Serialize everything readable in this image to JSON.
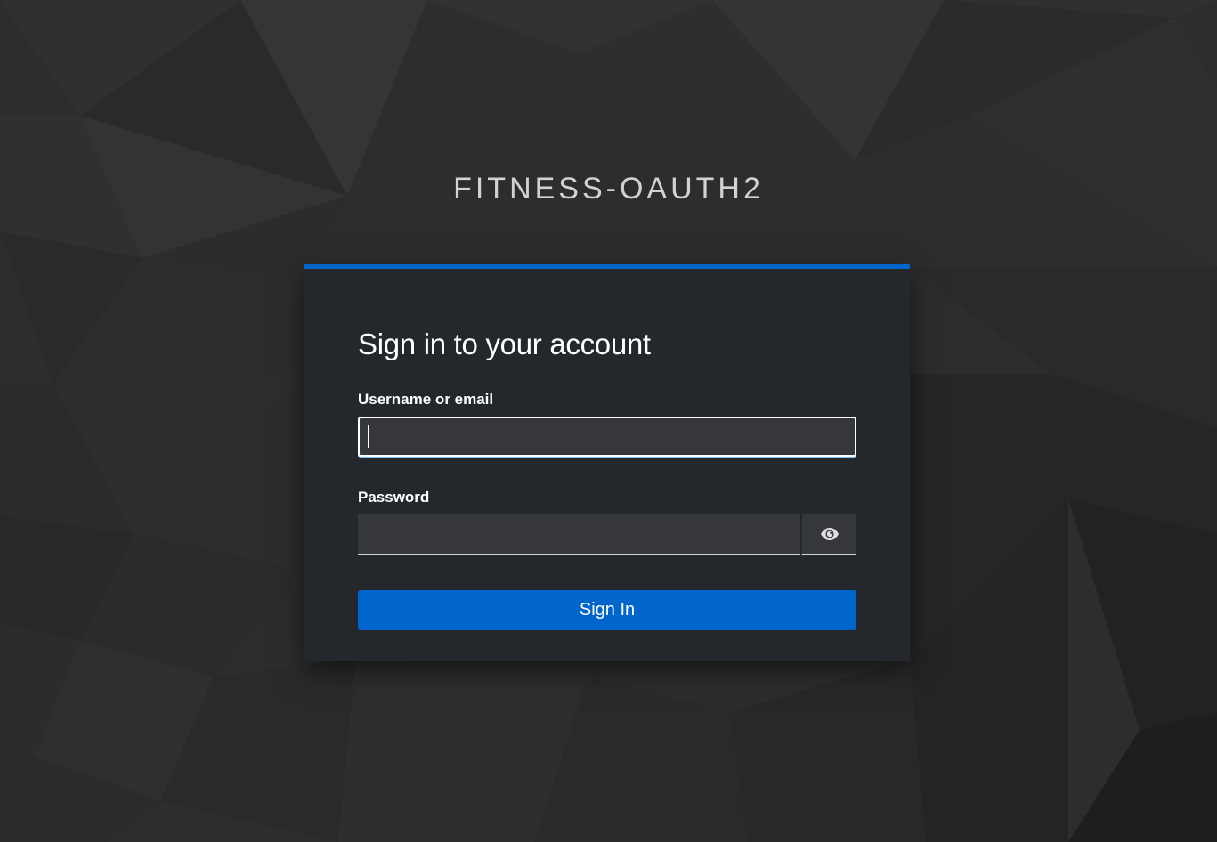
{
  "realm": {
    "title": "FITNESS-OAUTH2"
  },
  "login": {
    "heading": "Sign in to your account",
    "username_label": "Username or email",
    "username_value": "",
    "password_label": "Password",
    "password_value": "",
    "show_password_icon": "eye-icon",
    "submit_label": "Sign In"
  },
  "colors": {
    "accent": "#0066cc",
    "card_background": "#24272c",
    "input_background": "#36373b",
    "focus_underline": "#73bcf7"
  }
}
